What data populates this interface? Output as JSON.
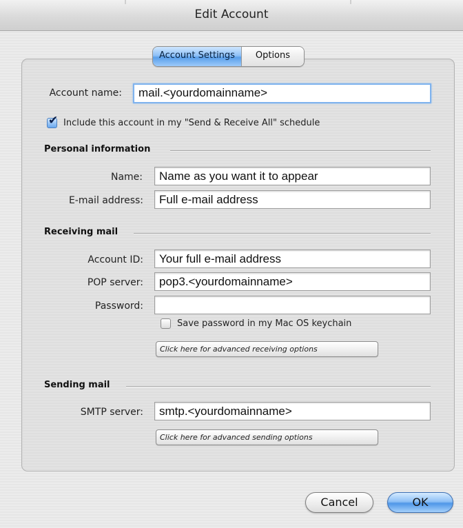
{
  "window": {
    "title": "Edit Account"
  },
  "tabs": [
    {
      "label": "Account Settings",
      "active": true
    },
    {
      "label": "Options",
      "active": false
    }
  ],
  "account": {
    "name_label": "Account name:",
    "name_value": "mail.<yourdomainname>",
    "include_checked": true,
    "include_label": "Include this account in my \"Send & Receive All\" schedule"
  },
  "personal": {
    "heading": "Personal information",
    "name_label": "Name:",
    "name_value": "Name as you want it to appear",
    "email_label": "E-mail address:",
    "email_value": "Full e-mail address"
  },
  "receiving": {
    "heading": "Receiving mail",
    "account_id_label": "Account ID:",
    "account_id_value": "Your full e-mail address",
    "pop_label": "POP server:",
    "pop_value": "pop3.<yourdomainname>",
    "password_label": "Password:",
    "password_value": "",
    "save_password_checked": false,
    "save_password_label": "Save password in my Mac OS keychain",
    "advanced_button": "Click here for advanced receiving options"
  },
  "sending": {
    "heading": "Sending mail",
    "smtp_label": "SMTP server:",
    "smtp_value": "smtp.<yourdomainname>",
    "advanced_button": "Click here for advanced sending options"
  },
  "buttons": {
    "cancel": "Cancel",
    "ok": "OK"
  },
  "colors": {
    "accent": "#6aa8ee",
    "focus_ring": "#7fb3ee"
  }
}
